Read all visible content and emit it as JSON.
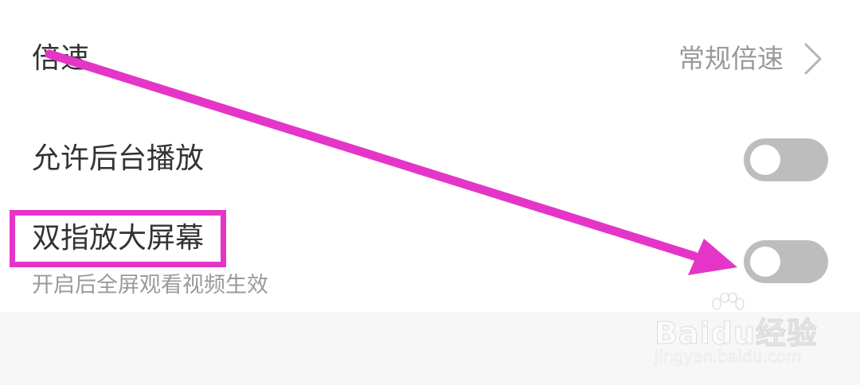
{
  "settings": {
    "speed": {
      "label": "倍速",
      "value": "常规倍速"
    },
    "background_play": {
      "label": "允许后台播放",
      "enabled": false
    },
    "pinch_zoom": {
      "label": "双指放大屏幕",
      "description": "开启后全屏观看视频生效",
      "enabled": false
    }
  },
  "annotation": {
    "color": "#e535c8"
  },
  "watermark": {
    "brand": "Bai",
    "brand_du": "du",
    "brand_cn": "经验",
    "url": "jingyan.baidu.com"
  },
  "colors": {
    "toggle_off": "#bdbdbd",
    "label": "#333333",
    "secondary": "#9a9a9a"
  },
  "icons": {
    "chevron": "chevron-right-icon",
    "paw": "baidu-paw-icon"
  }
}
